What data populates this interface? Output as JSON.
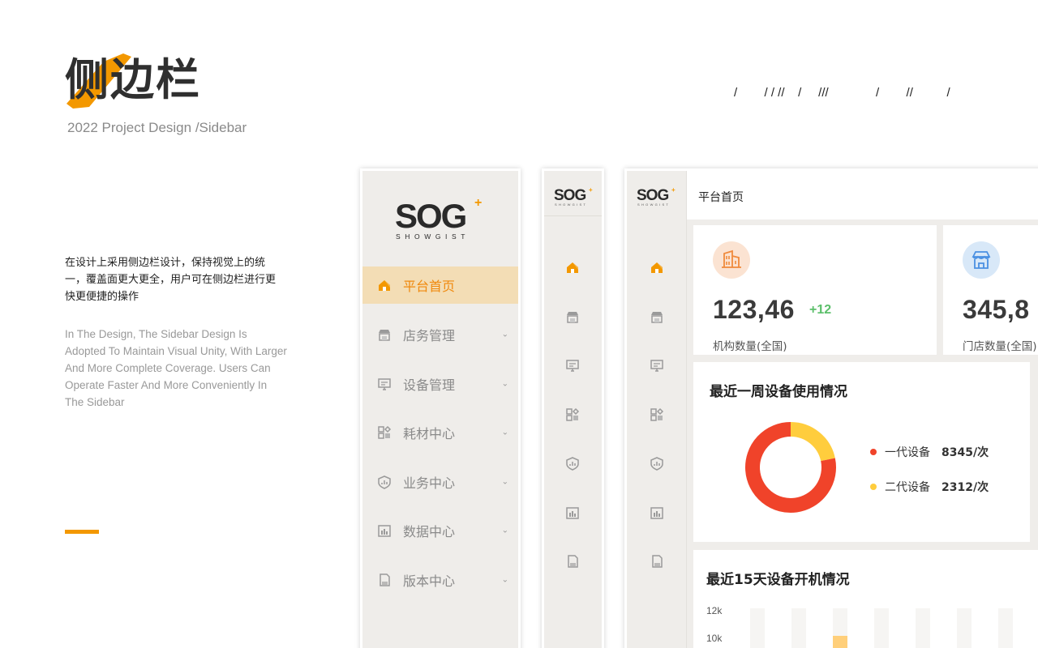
{
  "intro": {
    "title": "侧边栏",
    "subtitle": "2022 Project Design /Sidebar",
    "slashes": "/        / / //    /     ///              /        //          /",
    "desc_cn": "在设计上采用侧边栏设计，保持视觉上的统一，覆盖面更大更全，用户可在侧边栏进行更快更便捷的操作",
    "desc_en": "In The Design, The Sidebar Design Is Adopted To Maintain Visual Unity, With Larger And More Complete Coverage. Users Can Operate Faster And More Conveniently In The Sidebar",
    "accent_color": "#f39800"
  },
  "brand": {
    "logo_main": "SOG",
    "logo_sub": "SHOWGIST"
  },
  "sidebar": {
    "items": [
      {
        "label": "平台首页",
        "icon": "home-icon",
        "active": true
      },
      {
        "label": "店务管理",
        "icon": "store-icon"
      },
      {
        "label": "设备管理",
        "icon": "device-icon"
      },
      {
        "label": "耗材中心",
        "icon": "grid-icon"
      },
      {
        "label": "业务中心",
        "icon": "shield-chart-icon"
      },
      {
        "label": "数据中心",
        "icon": "data-icon"
      },
      {
        "label": "版本中心",
        "icon": "version-icon"
      }
    ],
    "chevron": "⌄"
  },
  "dashboard": {
    "page_title": "平台首页",
    "stats": [
      {
        "value": "123,46",
        "delta": "+12",
        "label": "机构数量(全国)",
        "icon": "building-icon"
      },
      {
        "value": "345,8",
        "label": "门店数量(全国)",
        "icon": "shop-icon"
      }
    ],
    "usage_chart": {
      "title": "最近一周设备使用情况",
      "legend": [
        {
          "name": "一代设备",
          "value": "8345/次",
          "color": "#f0432a"
        },
        {
          "name": "二代设备",
          "value": "2312/次",
          "color": "#ffcd3d"
        }
      ]
    },
    "boot_chart": {
      "title": "最近15天设备开机情况",
      "y_ticks": [
        "12k",
        "10k"
      ]
    }
  },
  "chart_data": {
    "type": "pie",
    "title": "最近一周设备使用情况",
    "labels": [
      "一代设备",
      "二代设备"
    ],
    "values": [
      8345,
      2312
    ],
    "colors": [
      "#f0432a",
      "#ffcd3d"
    ]
  }
}
